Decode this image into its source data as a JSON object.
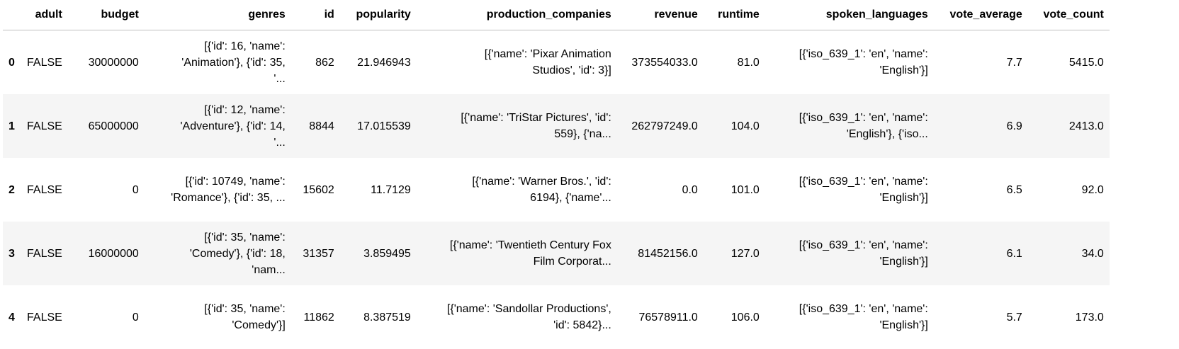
{
  "columns": [
    "",
    "adult",
    "budget",
    "genres",
    "id",
    "popularity",
    "production_companies",
    "revenue",
    "runtime",
    "spoken_languages",
    "vote_average",
    "vote_count"
  ],
  "rows": [
    [
      "0",
      "FALSE",
      "30000000",
      "[{'id': 16, 'name':\n'Animation'}, {'id': 35,\n'...",
      "862",
      "21.946943",
      "[{'name': 'Pixar Animation\nStudios', 'id': 3}]",
      "373554033.0",
      "81.0",
      "[{'iso_639_1': 'en', 'name':\n'English'}]",
      "7.7",
      "5415.0"
    ],
    [
      "1",
      "FALSE",
      "65000000",
      "[{'id': 12, 'name':\n'Adventure'}, {'id': 14,\n'...",
      "8844",
      "17.015539",
      "[{'name': 'TriStar Pictures', 'id':\n559}, {'na...",
      "262797249.0",
      "104.0",
      "[{'iso_639_1': 'en', 'name':\n'English'}, {'iso...",
      "6.9",
      "2413.0"
    ],
    [
      "2",
      "FALSE",
      "0",
      "[{'id': 10749, 'name':\n'Romance'}, {'id': 35, ...",
      "15602",
      "11.7129",
      "[{'name': 'Warner Bros.', 'id':\n6194}, {'name'...",
      "0.0",
      "101.0",
      "[{'iso_639_1': 'en', 'name':\n'English'}]",
      "6.5",
      "92.0"
    ],
    [
      "3",
      "FALSE",
      "16000000",
      "[{'id': 35, 'name':\n'Comedy'}, {'id': 18,\n'nam...",
      "31357",
      "3.859495",
      "[{'name': 'Twentieth Century Fox\nFilm Corporat...",
      "81452156.0",
      "127.0",
      "[{'iso_639_1': 'en', 'name':\n'English'}]",
      "6.1",
      "34.0"
    ],
    [
      "4",
      "FALSE",
      "0",
      "[{'id': 35, 'name':\n'Comedy'}]",
      "11862",
      "8.387519",
      "[{'name': 'Sandollar Productions',\n'id': 5842}...",
      "76578911.0",
      "106.0",
      "[{'iso_639_1': 'en', 'name':\n'English'}]",
      "5.7",
      "173.0"
    ]
  ]
}
